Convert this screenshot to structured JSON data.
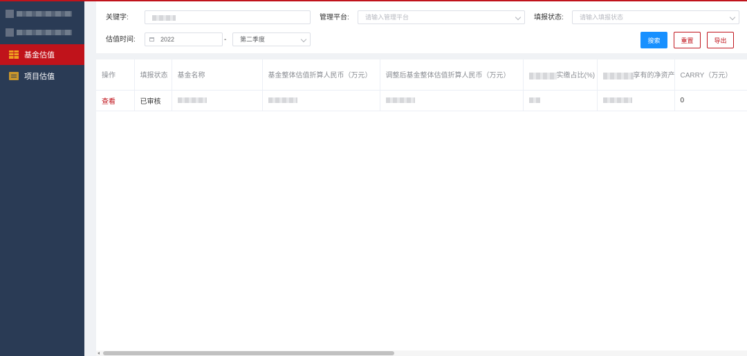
{
  "sidebar": {
    "items": [
      {
        "label": "基金估值",
        "icon": "fund-icon",
        "active": true
      },
      {
        "label": "项目估值",
        "icon": "project-icon",
        "active": false
      }
    ]
  },
  "search": {
    "keyword_label": "关键字:",
    "platform_label": "管理平台:",
    "platform_placeholder": "请输入管理平台",
    "status_label": "填报状态:",
    "status_placeholder": "请输入填报状态",
    "time_label": "估值时间:",
    "year_value": "2022",
    "range_separator": "-",
    "quarter_value": "第二季度",
    "search_button": "搜索",
    "reset_button": "重置",
    "export_button": "导出"
  },
  "table": {
    "headers": [
      "操作",
      "填报状态",
      "基金名称",
      "基金整体估值折算人民币（万元）",
      "调整后基金整体估值折算人民币（万元）",
      "实缴占比(%)",
      "享有的净资产",
      "CARRY（万元）"
    ],
    "rows": [
      {
        "action": "查看",
        "status": "已审核",
        "carry": "0"
      }
    ]
  },
  "colors": {
    "brand_red": "#c0131b",
    "primary_blue": "#1890ff",
    "sidebar_bg": "#2a3b55"
  }
}
